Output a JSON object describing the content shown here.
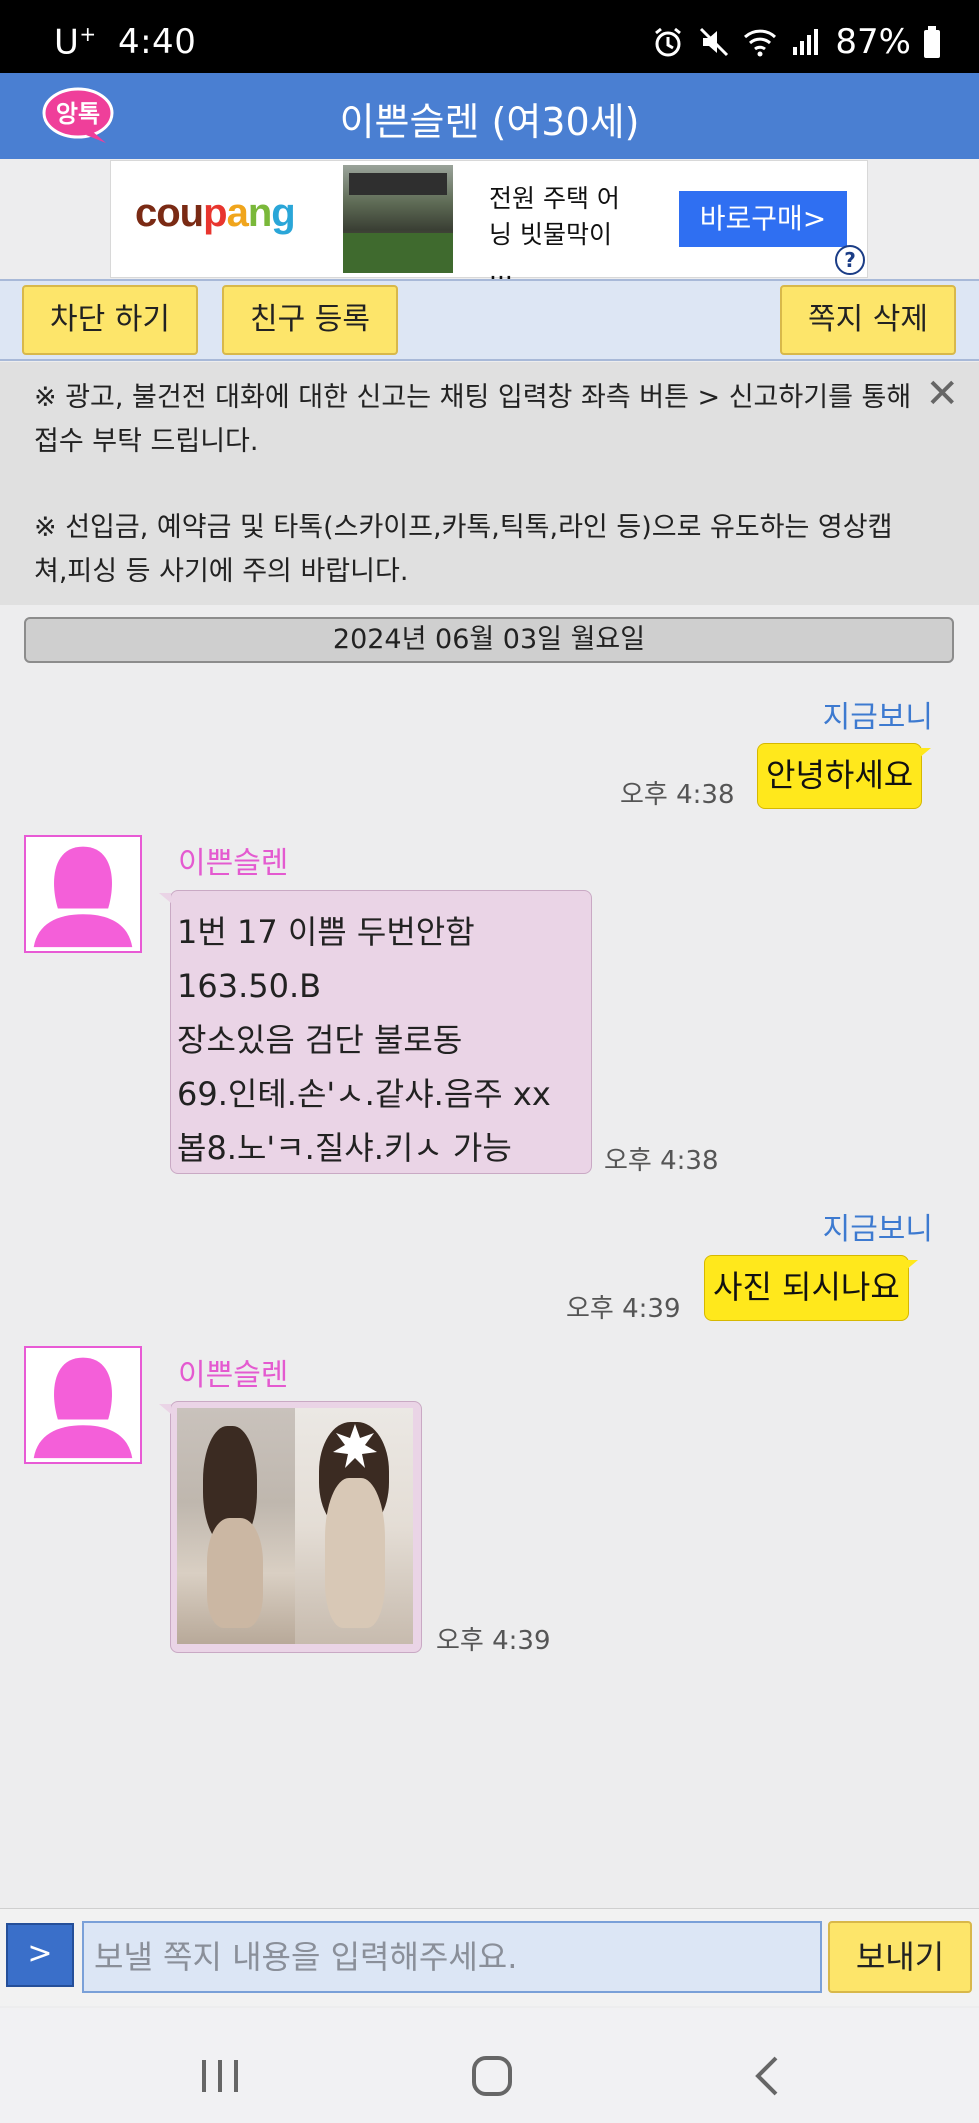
{
  "status_bar": {
    "carrier": "U",
    "carrier_sup": "+",
    "time": "4:40",
    "battery": "87%",
    "icons": [
      "alarm-icon",
      "mute-icon",
      "wifi-icon",
      "signal-icon",
      "battery-icon"
    ]
  },
  "header": {
    "logo_text": "앙톡",
    "title": "이쁜슬렌 (여30세)"
  },
  "ad": {
    "brand": "coupang",
    "text_line1": "전원 주택 어",
    "text_line2": "닝 빗물막이 ...",
    "button": "바로구매>",
    "help": "?"
  },
  "actions": {
    "block": "차단 하기",
    "add_friend": "친구 등록",
    "delete": "쪽지 삭제"
  },
  "notice": {
    "line1": "※ 광고, 불건전 대화에 대한 신고는 채팅 입력창 좌측 버튼 > 신고하기를 통해 접수 부탁 드립니다.",
    "line2": "※ 선입금, 예약금 및 타톡(스카이프,카톡,틱톡,라인 등)으로 유도하는 영상캡쳐,피싱 등 사기에 주의 바랍니다.",
    "close": "✕"
  },
  "date": "2024년 06월 03일 월요일",
  "messages": [
    {
      "from": "me",
      "sender": "지금보니",
      "text": "안녕하세요",
      "time": "오후 4:38"
    },
    {
      "from": "other",
      "sender": "이쁜슬렌",
      "text": "1번 17 이쁨 두번안함\n163.50.B\n장소있음 검단 불로동\n69.인톄.손'ㅅ.같샤.음주 xx\n봅8.노'ㅋ.질샤.키ㅅ 가능",
      "time": "오후 4:38"
    },
    {
      "from": "me",
      "sender": "지금보니",
      "text": "사진 되시나요",
      "time": "오후 4:39"
    },
    {
      "from": "other",
      "sender": "이쁜슬렌",
      "type": "photo",
      "time": "오후 4:39"
    }
  ],
  "input": {
    "menu_button": ">",
    "placeholder": "보낼 쪽지 내용을 입력해주세요.",
    "send_button": "보내기"
  },
  "nav": {
    "recent": "|||",
    "home": "○",
    "back": "<"
  },
  "colors": {
    "header_blue": "#4a7fd2",
    "my_bubble": "#ffe81c",
    "other_bubble": "#ead4e6",
    "my_name": "#3d7ad0",
    "other_name": "#e45ad0"
  }
}
